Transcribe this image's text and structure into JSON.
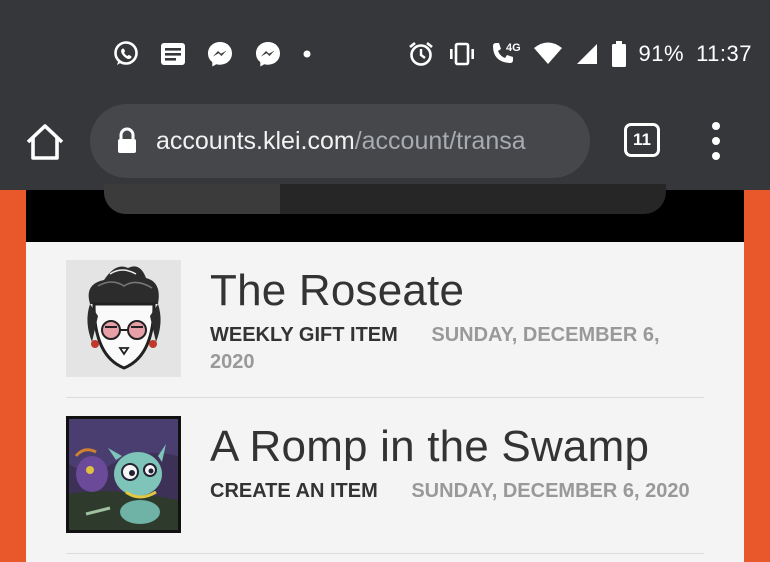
{
  "status_bar": {
    "notification_icons": [
      "whatsapp-icon",
      "message-icon",
      "messenger-icon",
      "messenger-icon",
      "more-dot-icon"
    ],
    "system_icons": [
      "alarm-icon",
      "vibrate-icon",
      "volte-call-icon",
      "wifi-icon",
      "cell-signal-icon",
      "battery-icon"
    ],
    "network_label": "4G",
    "battery": "91%",
    "time": "11:37"
  },
  "browser": {
    "url_host": "accounts.klei.com",
    "url_path": "/account/transa",
    "tab_count": "11"
  },
  "transactions": [
    {
      "title": "The Roseate",
      "type": "WEEKLY GIFT ITEM",
      "date": "SUNDAY, DECEMBER 6, 2020",
      "thumbnail_icon": "roseate-character-icon"
    },
    {
      "title": "A Romp in the Swamp",
      "type": "CREATE AN ITEM",
      "date": "SUNDAY, DECEMBER 6, 2020",
      "thumbnail_icon": "swamp-creature-icon"
    }
  ],
  "colors": {
    "chrome_bar": "#35373a",
    "url_bar": "#45474a",
    "page_accent": "#e8582a",
    "content_bg": "#f4f4f4"
  }
}
